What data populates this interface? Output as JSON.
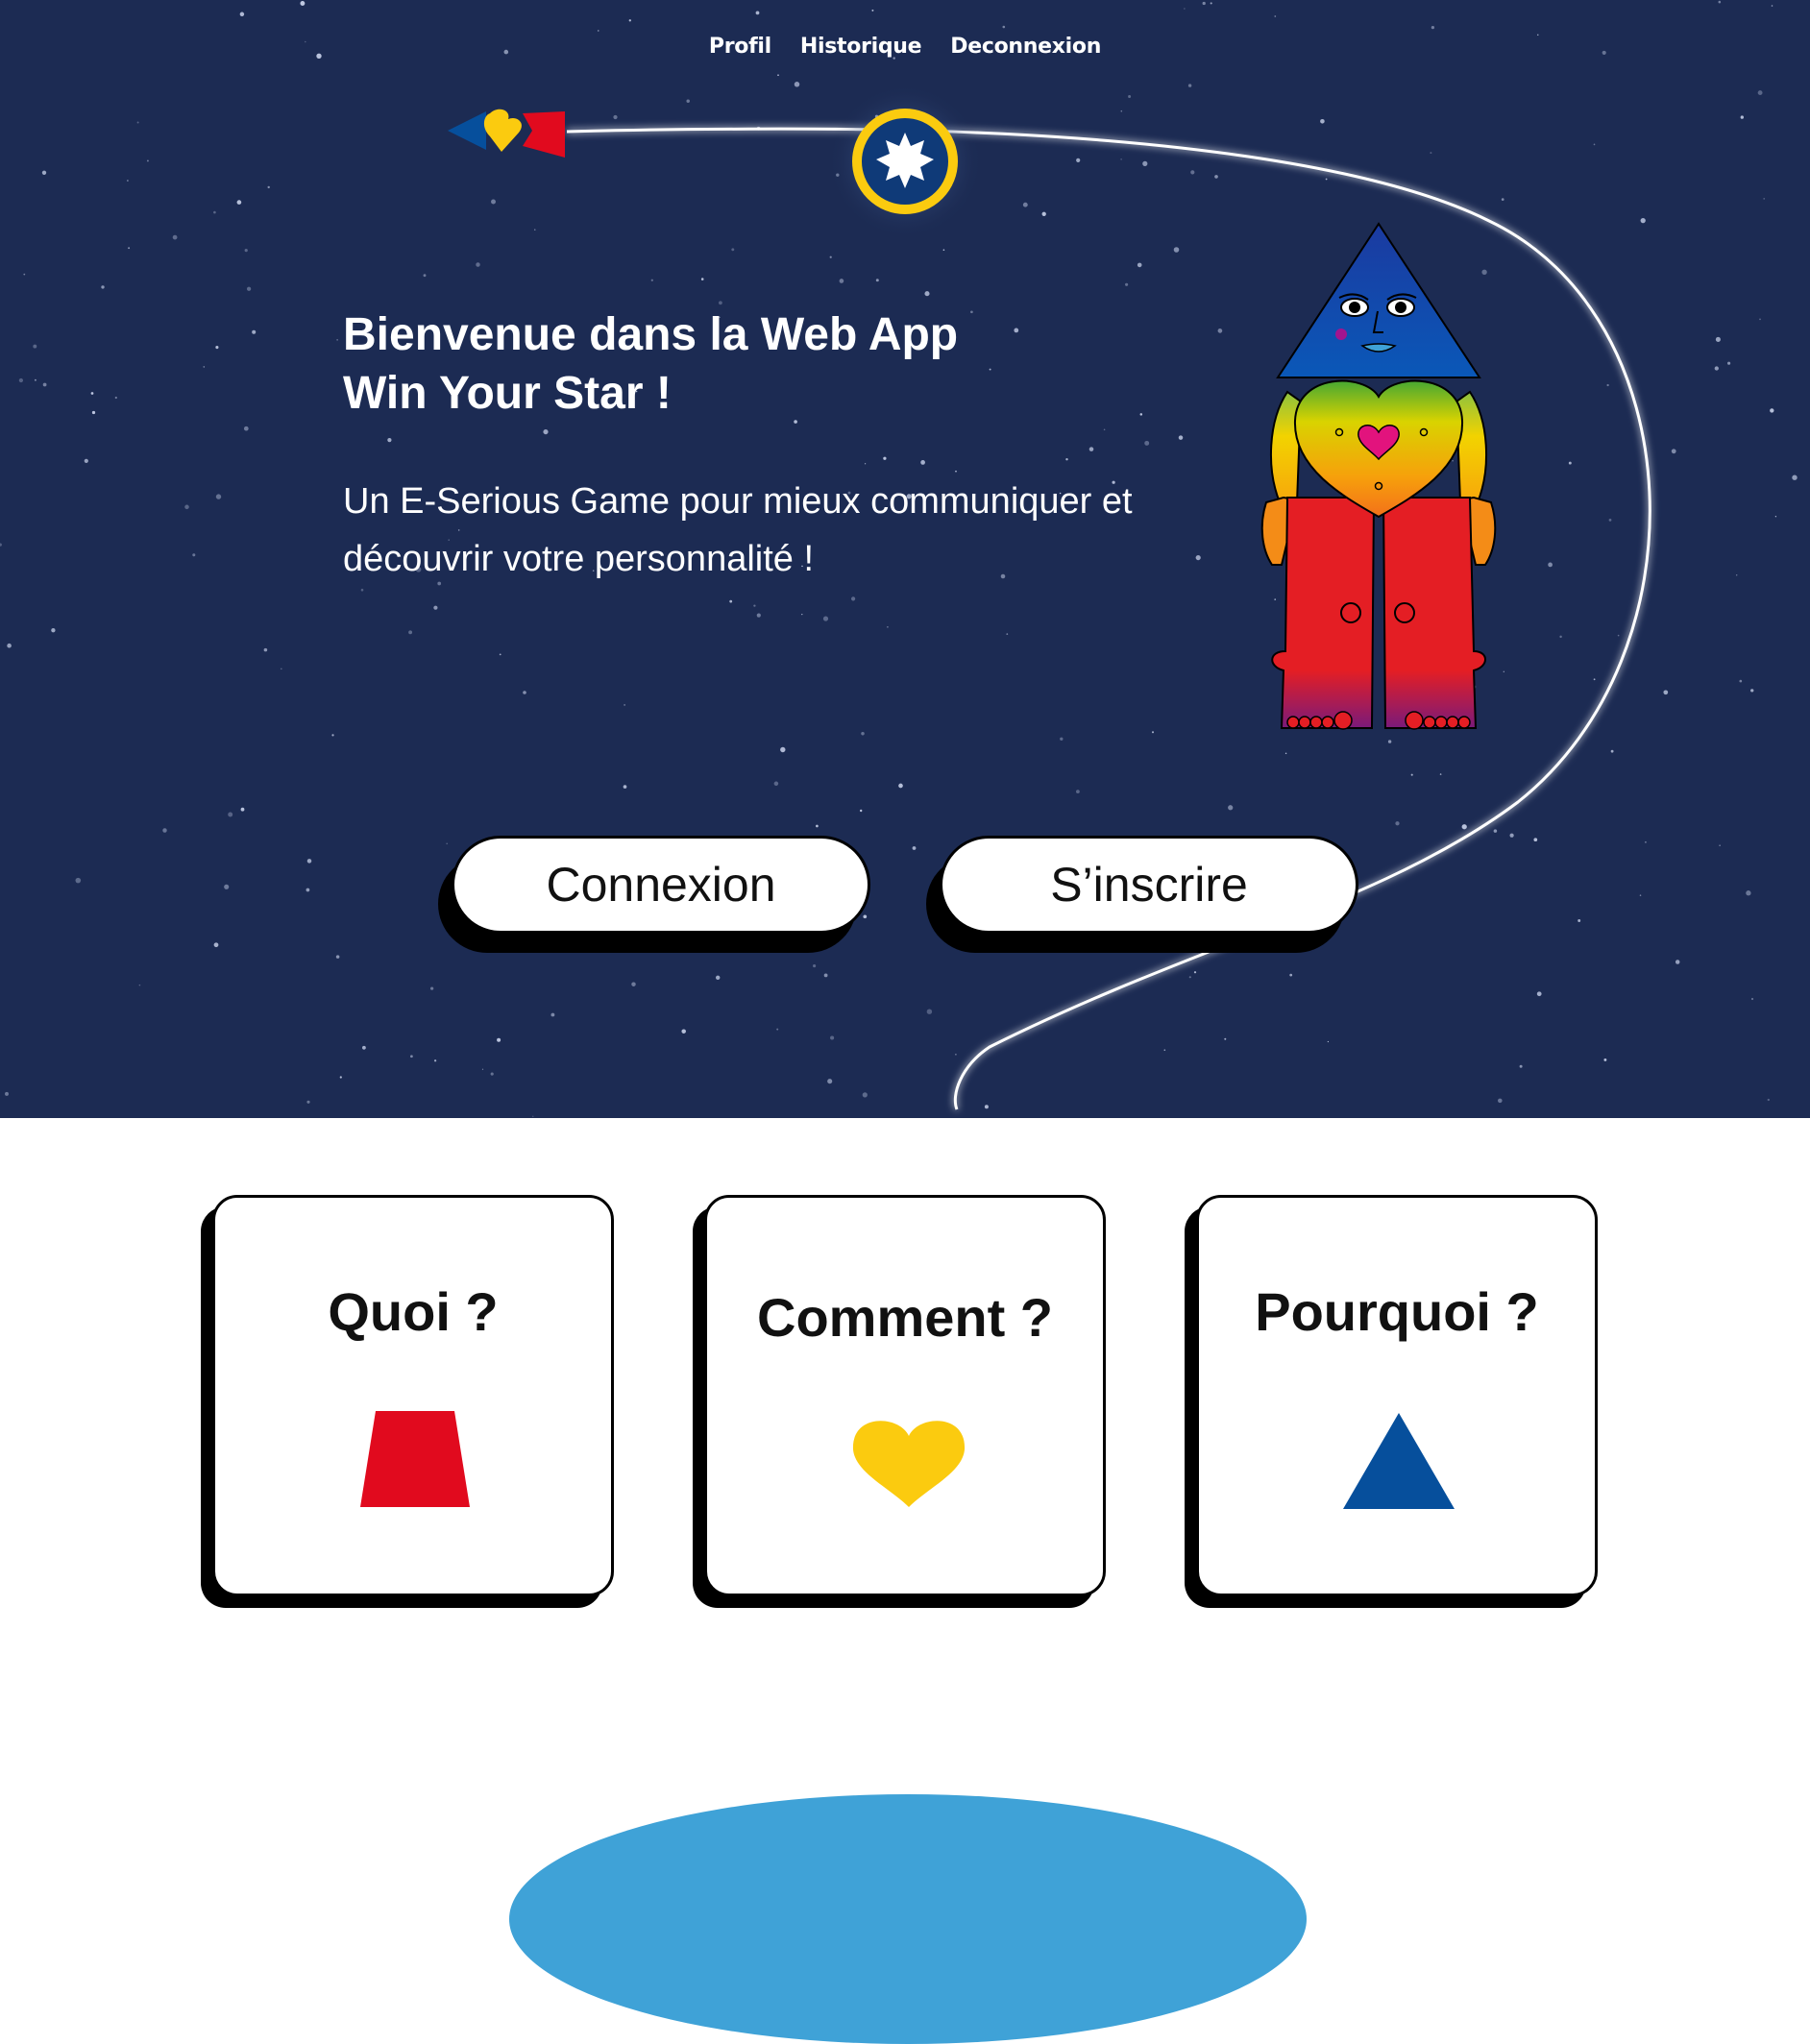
{
  "nav": {
    "items": [
      "Profil",
      "Historique",
      "Deconnexion"
    ]
  },
  "hero": {
    "title_line1": "Bienvenue dans la Web App",
    "title_line2": "Win Your Star !",
    "subtitle_line1": "Un E-Serious Game pour mieux communiquer et",
    "subtitle_line2": "découvrir votre personnalité !",
    "background_color": "#1c2b53"
  },
  "buttons": {
    "login": "Connexion",
    "signup": "S’inscrire"
  },
  "cards": [
    {
      "title": "Quoi ?",
      "shape": "trapezoid",
      "color": "#e10a1e"
    },
    {
      "title": "Comment ?",
      "shape": "heart",
      "color": "#fbcb0f"
    },
    {
      "title": "Pourquoi ?",
      "shape": "triangle",
      "color": "#064f9c"
    }
  ],
  "colors": {
    "red": "#e10a1e",
    "yellow": "#fbcb0f",
    "blue": "#064f9c",
    "sky": "#3fa2d7"
  }
}
